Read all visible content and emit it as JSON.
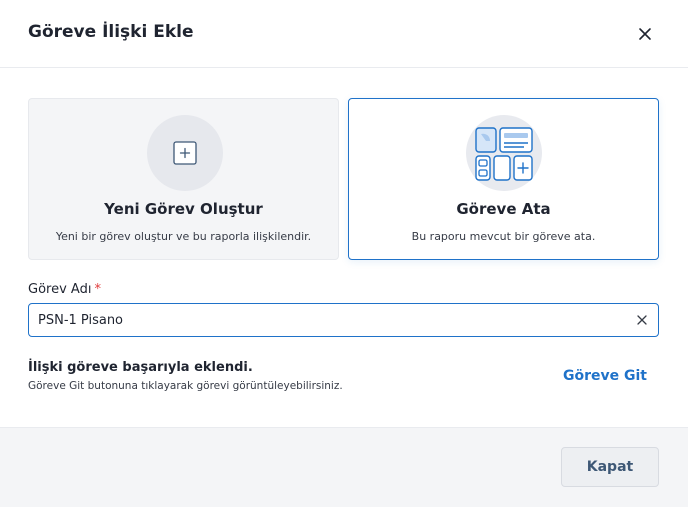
{
  "dialog": {
    "title": "Göreve İlişki Ekle"
  },
  "options": [
    {
      "title": "Yeni Görev Oluştur",
      "description": "Yeni bir görev oluştur ve bu raporla ilişkilendir.",
      "icon": "plus-square-icon",
      "selected": false
    },
    {
      "title": "Göreve Ata",
      "description": "Bu raporu mevcut bir göreve ata.",
      "icon": "dashboard-widgets-icon",
      "selected": true
    }
  ],
  "form": {
    "task_name_label": "Görev Adı",
    "required_mark": "*",
    "task_name_value": "PSN-1 Pisano"
  },
  "success": {
    "title": "İlişki göreve başarıyla eklendi.",
    "description": "Göreve Git butonuna tıklayarak görevi görüntüleyebilirsiniz.",
    "link_label": "Göreve Git"
  },
  "footer": {
    "close_label": "Kapat"
  },
  "colors": {
    "accent": "#1f72c9",
    "required": "#e03a3a",
    "card_bg": "#f4f5f7",
    "footer_bg": "#f4f5f7"
  }
}
